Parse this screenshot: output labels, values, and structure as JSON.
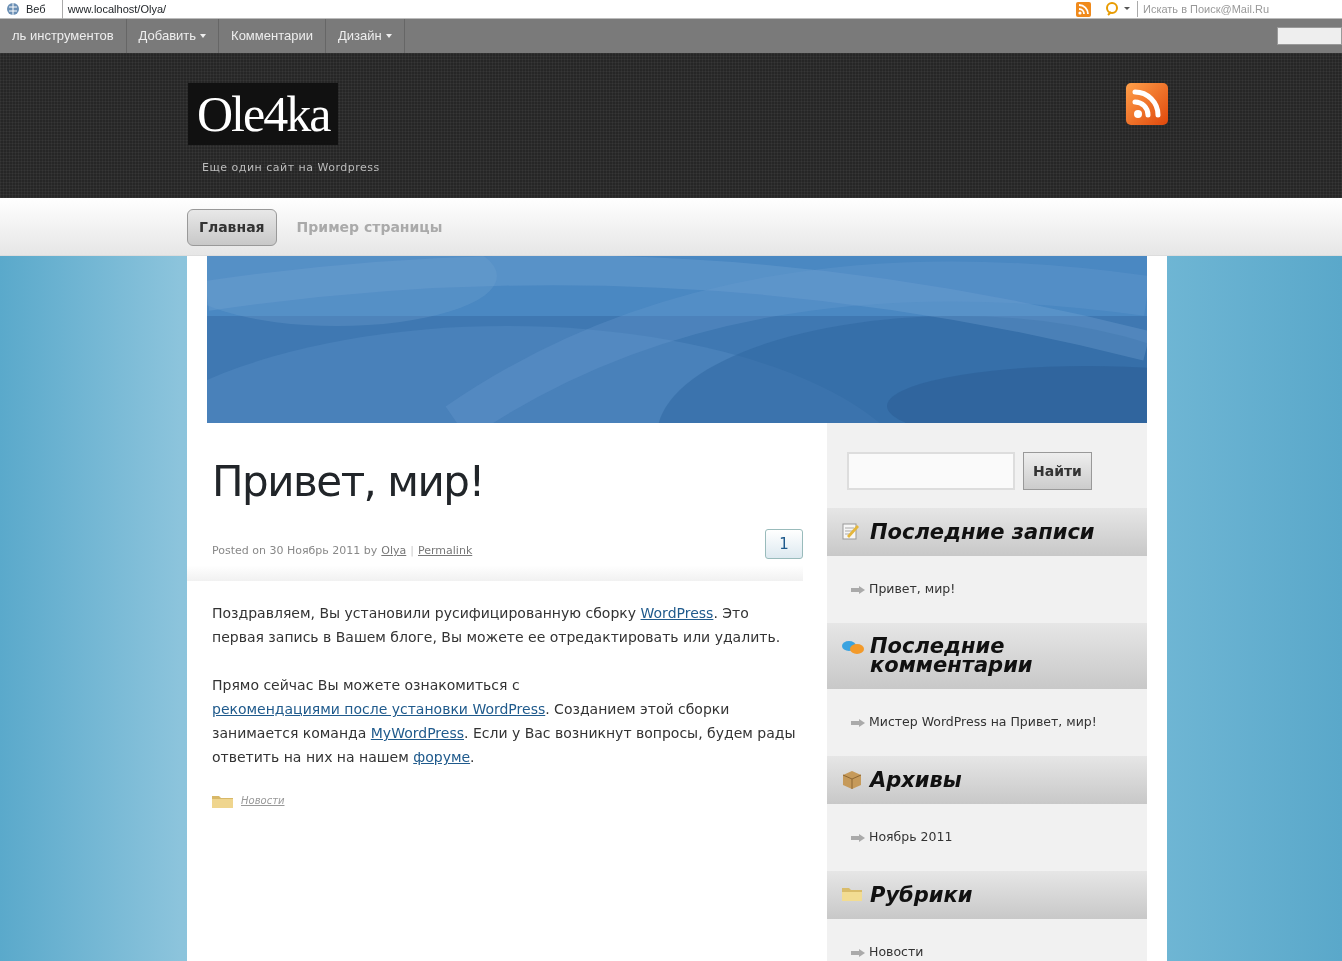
{
  "browser_toolbar": {
    "label": "Веб",
    "address": "www.localhost/Olya/",
    "search_placeholder": "Искать в Поиск@Mail.Ru"
  },
  "admin_bar": {
    "items": [
      {
        "label": "ль инструментов",
        "dropdown": false
      },
      {
        "label": "Добавить",
        "dropdown": true
      },
      {
        "label": "Комментарии",
        "dropdown": false
      },
      {
        "label": "Дизайн",
        "dropdown": true
      }
    ]
  },
  "header": {
    "logo": "Ole4ka",
    "tagline": "Еще один сайт на Wordpress"
  },
  "nav": [
    {
      "label": "Главная",
      "selected": true
    },
    {
      "label": "Пример страницы",
      "selected": false
    }
  ],
  "post": {
    "title": "Привет, мир!",
    "meta_prefix": "Posted on 30 Ноябрь 2011 by",
    "author": "Olya",
    "separator": "|",
    "permalink": "Permalink",
    "comment_count": "1",
    "paragraphs": [
      [
        {
          "text": "Поздравляем, Вы установили русифицированную сборку "
        },
        {
          "link": "WordPress"
        },
        {
          "text": ". Это первая запись в Вашем блоге, Вы можете ее отредактировать или удалить."
        }
      ],
      [
        {
          "text": "Прямо сейчас Вы можете ознакомиться с "
        },
        {
          "link": "рекомендациями после установки WordPress"
        },
        {
          "text": ". Созданием этой сборки занимается команда "
        },
        {
          "link": "MyWordPress"
        },
        {
          "text": ". Если у Вас возникнут вопросы, будем рады ответить на них на нашем "
        },
        {
          "link": "форуме"
        },
        {
          "text": "."
        }
      ]
    ],
    "category": "Новости"
  },
  "sidebar": {
    "search_button": "Найти",
    "widgets": [
      {
        "kind": "notes",
        "title": "Последние записи",
        "items": [
          "Привет, мир!"
        ]
      },
      {
        "kind": "comments",
        "title": "Последние комментарии",
        "items": [
          "Мистер WordPress на Привет, мир!"
        ]
      },
      {
        "kind": "archive",
        "title": "Архивы",
        "items": [
          "Ноябрь 2011"
        ]
      },
      {
        "kind": "folder",
        "title": "Рубрики",
        "items": [
          "Новости"
        ]
      }
    ]
  }
}
